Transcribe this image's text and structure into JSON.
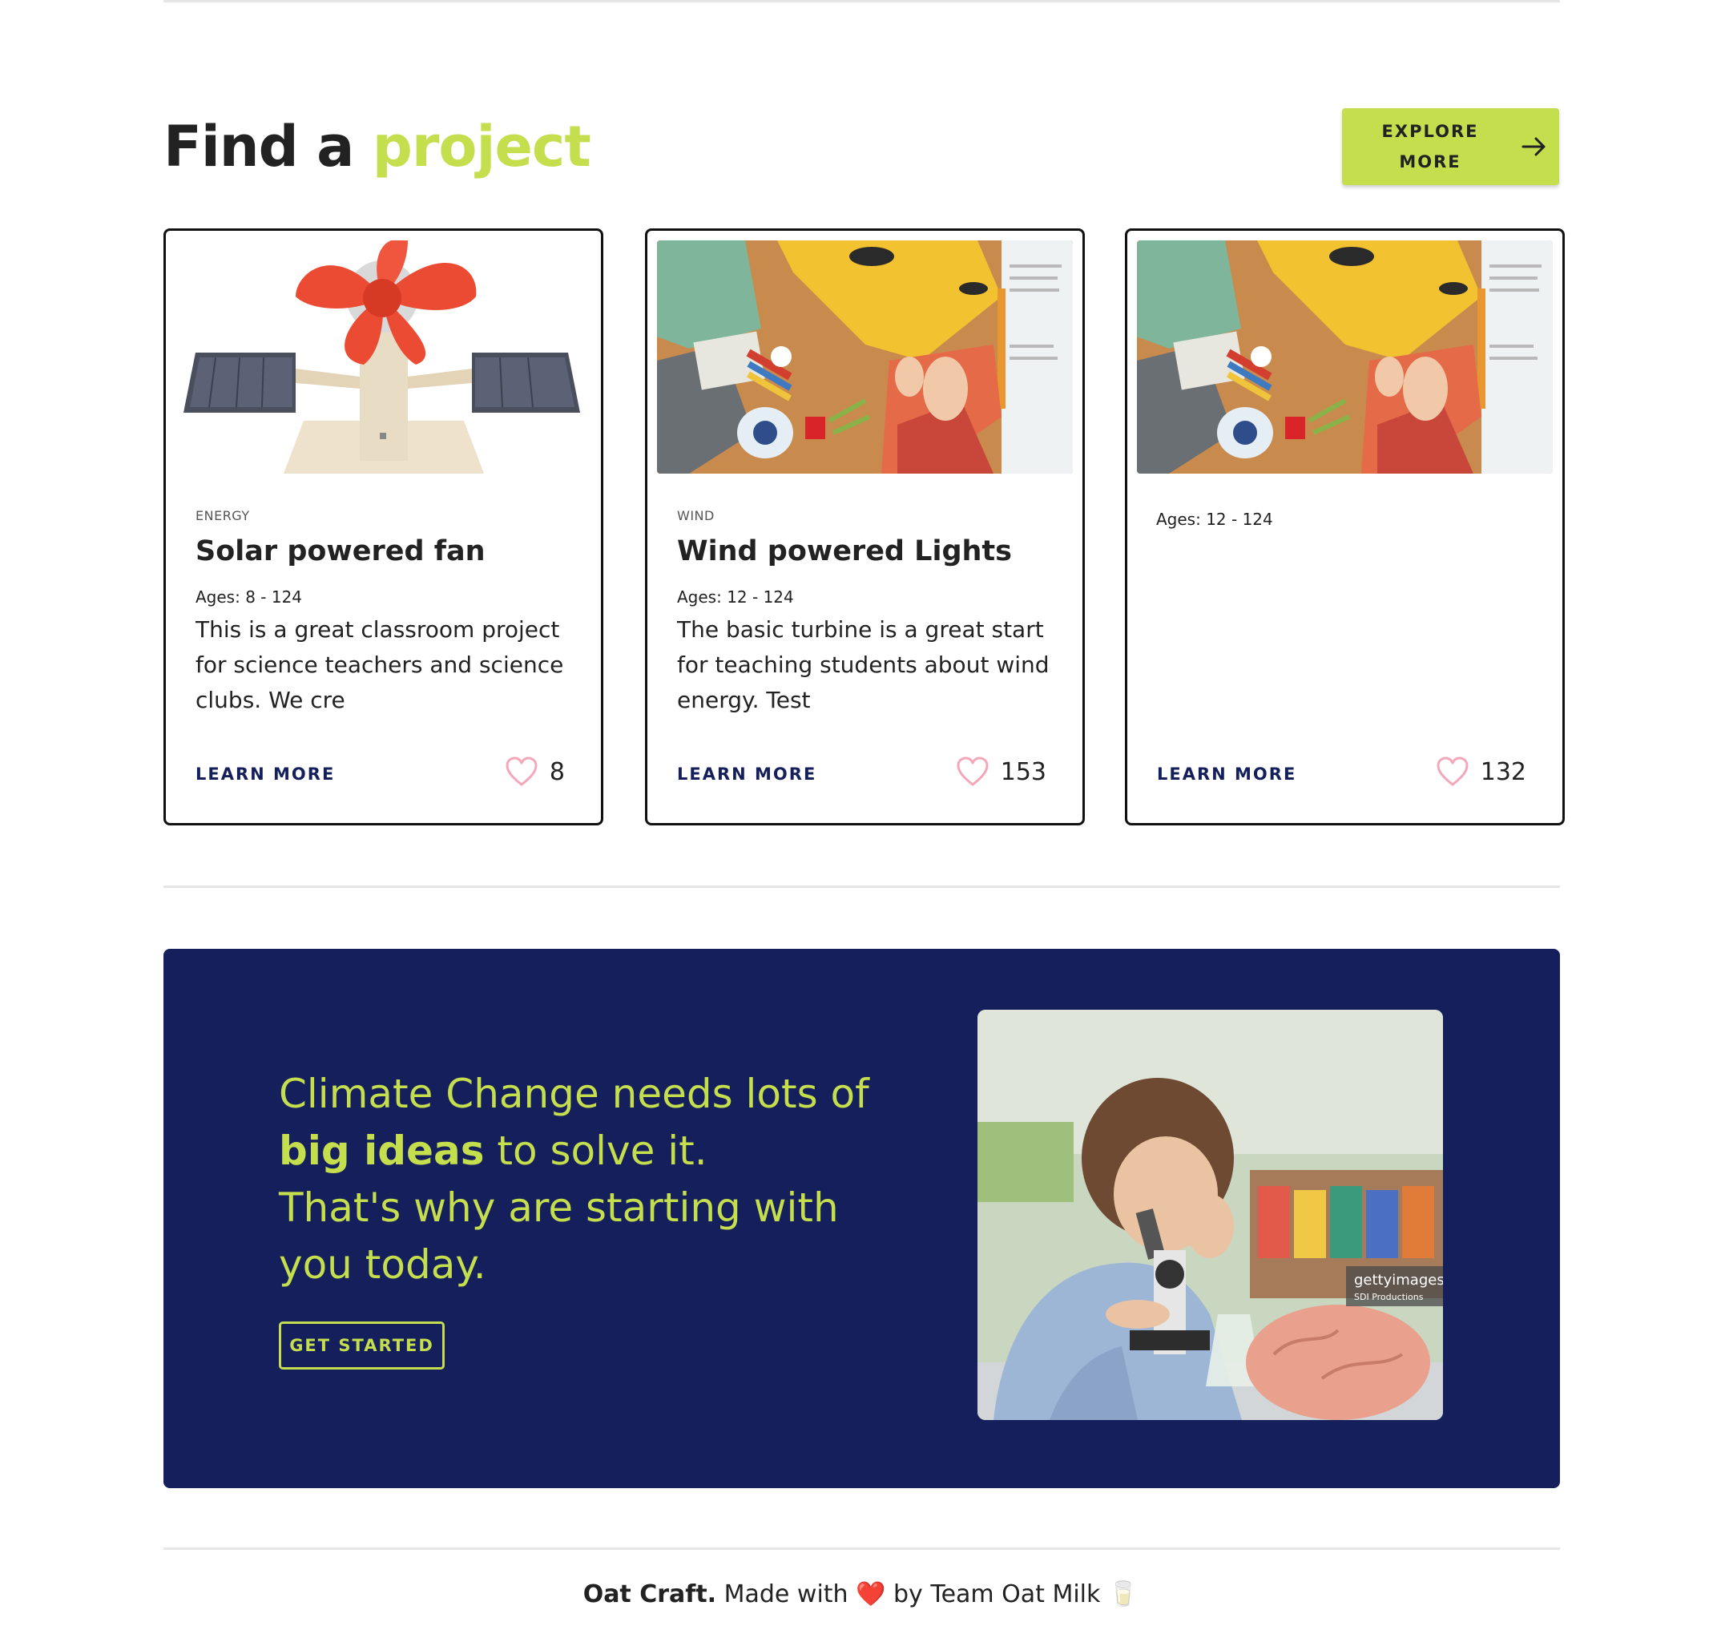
{
  "section": {
    "heading_prefix": "Find a",
    "heading_accent": "project",
    "explore_line1": "EXPLORE",
    "explore_line2": "MORE"
  },
  "cards": [
    {
      "category": "ENERGY",
      "title": "Solar powered fan",
      "ages": "Ages: 8 - 124",
      "description": "This is a great classroom project for science teachers and science clubs. We cre",
      "learn_more": "LEARN MORE",
      "likes": "8"
    },
    {
      "category": "WIND",
      "title": "Wind powered Lights",
      "ages": "Ages: 12 - 124",
      "description": "The basic turbine is a great start for teaching students about wind energy. Test",
      "learn_more": "LEARN MORE",
      "likes": "153"
    },
    {
      "category": "",
      "title": "",
      "ages": "Ages: 12 - 124",
      "description": "",
      "learn_more": "LEARN MORE",
      "likes": "132"
    }
  ],
  "banner": {
    "line1": "Climate Change needs lots of",
    "bold": "big ideas",
    "line2_rest": " to solve it.",
    "line3": "That's why are starting with you today.",
    "cta": "GET STARTED",
    "watermark_brand": "gettyimages",
    "watermark_credit": "SDI Productions"
  },
  "footer": {
    "brand": "Oat Craft.",
    "made_with": " Made with ",
    "heart": "❤️",
    "by": " by Team Oat Milk ",
    "emoji": "🥛"
  },
  "colors": {
    "accent": "#c5de4d",
    "navy": "#141f5b",
    "like_heart": "#f4a7b9"
  }
}
